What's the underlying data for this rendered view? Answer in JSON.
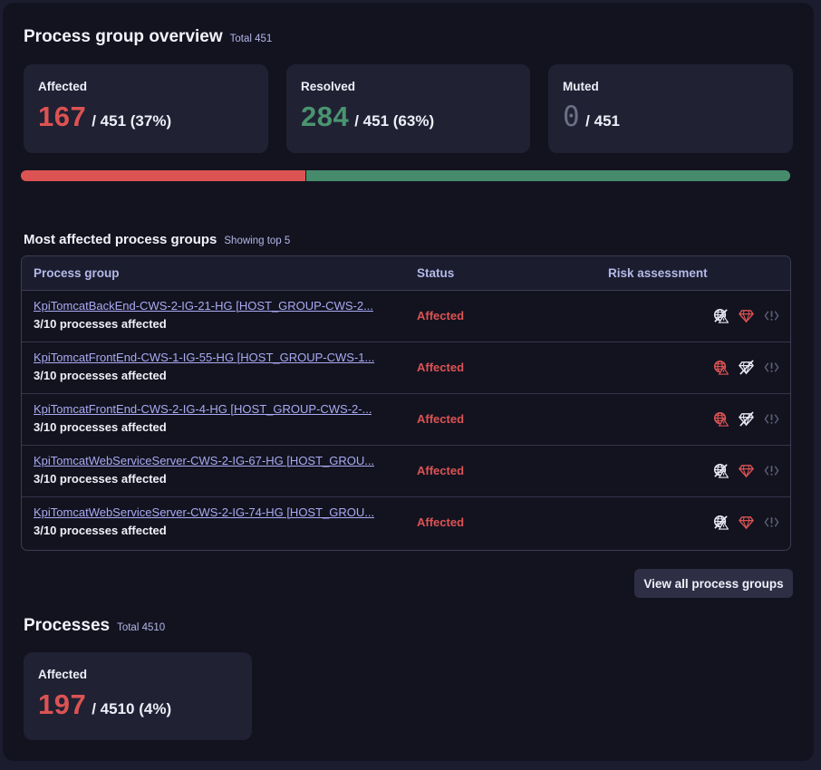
{
  "overview": {
    "title": "Process group overview",
    "total_label": "Total 451",
    "cards": [
      {
        "label": "Affected",
        "count": "167",
        "rest": "/ 451 (37%)",
        "tone": "red"
      },
      {
        "label": "Resolved",
        "count": "284",
        "rest": "/ 451 (63%)",
        "tone": "green"
      },
      {
        "label": "Muted",
        "count": "0",
        "rest": "/ 451",
        "tone": "muted"
      }
    ],
    "progress": {
      "affected_fraction": 0.37,
      "resolved_fraction": 0.63,
      "colors": {
        "affected": "#dc5353",
        "resolved": "#468c6c"
      }
    }
  },
  "most_affected": {
    "title": "Most affected process groups",
    "subtitle": "Showing top 5",
    "columns": [
      "Process group",
      "Status",
      "Risk assessment"
    ],
    "rows": [
      {
        "name": "KpiTomcatBackEnd-CWS-2-IG-21-HG [HOST_GROUP-CWS-2...",
        "desc": "3/10 processes affected",
        "status": "Affected",
        "risk": {
          "public_exposure": "not-exposed",
          "data_assets": "reachable",
          "vulnerable_function": "not-available"
        }
      },
      {
        "name": "KpiTomcatFrontEnd-CWS-1-IG-55-HG [HOST_GROUP-CWS-1...",
        "desc": "3/10 processes affected",
        "status": "Affected",
        "risk": {
          "public_exposure": "exposed",
          "data_assets": "not-reachable",
          "vulnerable_function": "not-available"
        }
      },
      {
        "name": "KpiTomcatFrontEnd-CWS-2-IG-4-HG [HOST_GROUP-CWS-2-...",
        "desc": "3/10 processes affected",
        "status": "Affected",
        "risk": {
          "public_exposure": "exposed",
          "data_assets": "not-reachable",
          "vulnerable_function": "not-available"
        }
      },
      {
        "name": "KpiTomcatWebServiceServer-CWS-2-IG-67-HG [HOST_GROU...",
        "desc": "3/10 processes affected",
        "status": "Affected",
        "risk": {
          "public_exposure": "not-exposed",
          "data_assets": "reachable",
          "vulnerable_function": "not-available"
        }
      },
      {
        "name": "KpiTomcatWebServiceServer-CWS-2-IG-74-HG [HOST_GROU...",
        "desc": "3/10 processes affected",
        "status": "Affected",
        "risk": {
          "public_exposure": "not-exposed",
          "data_assets": "reachable",
          "vulnerable_function": "not-available"
        }
      }
    ],
    "view_all_label": "View all process groups"
  },
  "processes": {
    "title": "Processes",
    "total_label": "Total 4510",
    "card": {
      "label": "Affected",
      "count": "197",
      "rest": "/ 4510 (4%)",
      "tone": "red"
    }
  },
  "colors": {
    "red": "#dc5353",
    "green": "#468c6c",
    "muted": "#6c6e86",
    "link": "#a9aaf2",
    "icon_white": "#e8e8f4",
    "icon_gray": "#5e6078"
  }
}
